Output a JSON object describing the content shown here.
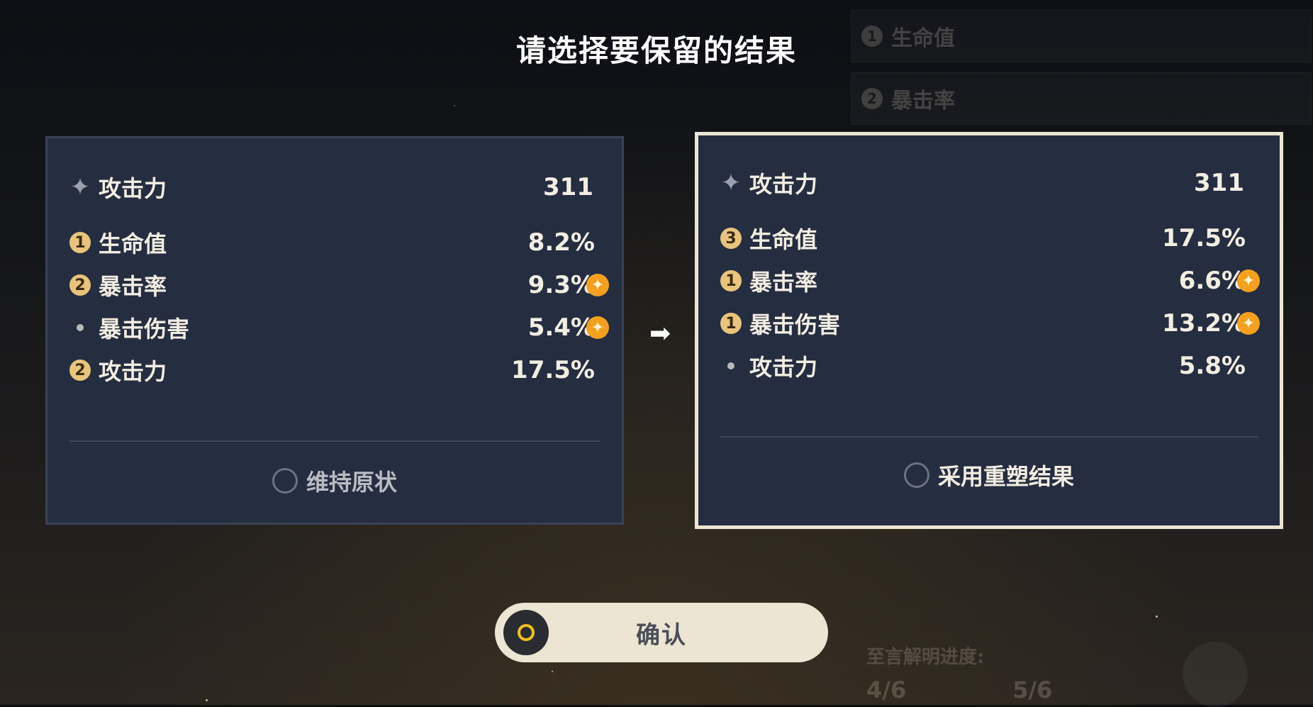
{
  "title": "请选择要保留的结果",
  "background": {
    "stats": [
      {
        "num": "1",
        "label": "生命值"
      },
      {
        "num": "2",
        "label": "暴击率"
      }
    ],
    "progress_label": "至言解明进度:",
    "progress_from": "4/6",
    "progress_to": "5/6"
  },
  "left_panel": {
    "main_stat": {
      "label": "攻击力",
      "value": "311"
    },
    "substats": [
      {
        "badge": "1",
        "label": "生命值",
        "value": "8.2%",
        "enhanced": false
      },
      {
        "badge": "2",
        "label": "暴击率",
        "value": "9.3%",
        "enhanced": true
      },
      {
        "badge": "",
        "label": "暴击伤害",
        "value": "5.4%",
        "enhanced": true
      },
      {
        "badge": "2",
        "label": "攻击力",
        "value": "17.5%",
        "enhanced": false
      }
    ],
    "option_label": "维持原状"
  },
  "right_panel": {
    "main_stat": {
      "label": "攻击力",
      "value": "311"
    },
    "substats": [
      {
        "badge": "3",
        "label": "生命值",
        "value": "17.5%",
        "enhanced": false
      },
      {
        "badge": "1",
        "label": "暴击率",
        "value": "6.6%",
        "enhanced": true
      },
      {
        "badge": "1",
        "label": "暴击伤害",
        "value": "13.2%",
        "enhanced": true
      },
      {
        "badge": "",
        "label": "攻击力",
        "value": "5.8%",
        "enhanced": false
      }
    ],
    "option_label": "采用重塑结果"
  },
  "confirm_label": "确认",
  "colors": {
    "panel_bg": "#252d40",
    "selected_border": "#ece5d3",
    "badge": "#e8c47c",
    "enhance_star": "#f3a01e",
    "confirm_ring": "#f0c01f"
  }
}
